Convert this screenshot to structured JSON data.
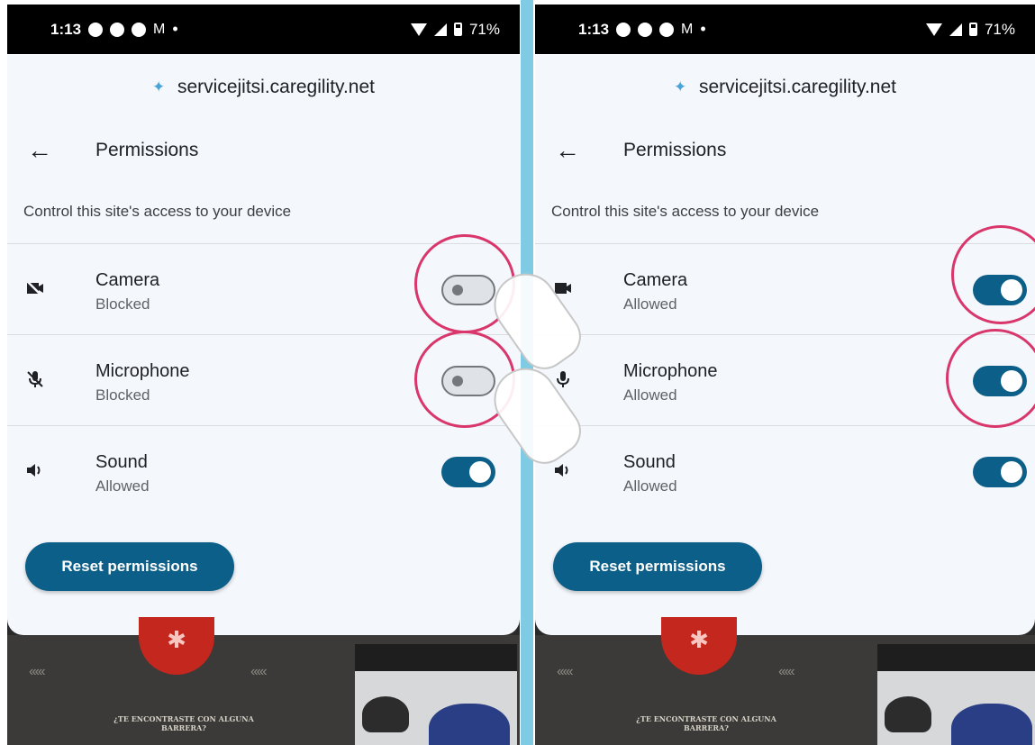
{
  "status_bar": {
    "time": "1:13",
    "battery": "71%",
    "mail_glyph": "M",
    "separator": "•"
  },
  "site": {
    "url": "servicejitsi.caregility.net",
    "site_icon": "puzzle-icon"
  },
  "header": {
    "back_glyph": "←",
    "title": "Permissions"
  },
  "subtitle": "Control this site's access to your device",
  "panels": {
    "left": {
      "camera": {
        "label": "Camera",
        "status": "Blocked",
        "toggle": "off"
      },
      "microphone": {
        "label": "Microphone",
        "status": "Blocked",
        "toggle": "off"
      },
      "sound": {
        "label": "Sound",
        "status": "Allowed",
        "toggle": "on"
      }
    },
    "right": {
      "camera": {
        "label": "Camera",
        "status": "Allowed",
        "toggle": "on"
      },
      "microphone": {
        "label": "Microphone",
        "status": "Allowed",
        "toggle": "on"
      },
      "sound": {
        "label": "Sound",
        "status": "Allowed",
        "toggle": "on"
      }
    }
  },
  "reset_button": "Reset permissions",
  "background": {
    "poster_text": "¿TE ENCONTRASTE CON ALGUNA BARRERA?",
    "arrows": "‹‹‹‹‹"
  },
  "colors": {
    "accent": "#0c5f88",
    "highlight": "#d9366b",
    "divider": "#7fcbe3",
    "sheet": "#f4f8fc"
  }
}
